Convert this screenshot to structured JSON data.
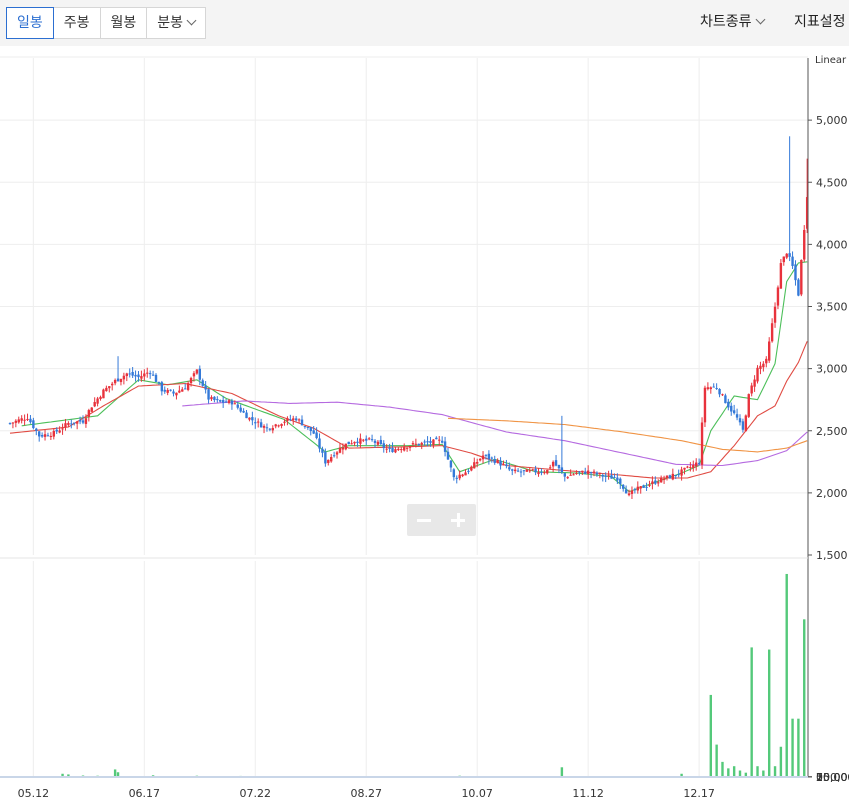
{
  "toolbar": {
    "tabs": [
      {
        "label": "일봉",
        "active": true
      },
      {
        "label": "주봉",
        "active": false
      },
      {
        "label": "월봉",
        "active": false
      },
      {
        "label": "분봉",
        "active": false
      }
    ],
    "chart_type_label": "차트종류",
    "indicator_label": "지표설정"
  },
  "colors": {
    "up": "#e8323c",
    "down": "#3479d8",
    "ma5": "#4cbf5a",
    "ma20": "#e04b43",
    "ma60": "#b56ae0",
    "ma120": "#f09445",
    "volume": "#54c97a"
  },
  "chart_data": [
    {
      "type": "candlestick",
      "scale_label": "Linear",
      "y_ticks": [
        "5,000",
        "4,500",
        "4,000",
        "3,500",
        "3,000",
        "2,500",
        "2,000",
        "1,500"
      ],
      "ylim": [
        1500,
        5500
      ],
      "x_ticks": [
        "05.12",
        "06.17",
        "07.22",
        "08.27",
        "10.07",
        "11.12",
        "12.17"
      ],
      "series": [
        {
          "kind": "price",
          "keypoints": [
            [
              0,
              2560
            ],
            [
              6,
              2610
            ],
            [
              10,
              2460
            ],
            [
              15,
              2480
            ],
            [
              20,
              2560
            ],
            [
              25,
              2580
            ],
            [
              28,
              2700
            ],
            [
              32,
              2820
            ],
            [
              36,
              2900
            ],
            [
              40,
              2960
            ],
            [
              44,
              2930
            ],
            [
              48,
              2980
            ],
            [
              52,
              2830
            ],
            [
              56,
              2800
            ],
            [
              60,
              2850
            ],
            [
              64,
              2980
            ],
            [
              68,
              2760
            ],
            [
              72,
              2730
            ],
            [
              76,
              2730
            ],
            [
              82,
              2600
            ],
            [
              88,
              2520
            ],
            [
              94,
              2580
            ],
            [
              98,
              2600
            ],
            [
              104,
              2480
            ],
            [
              108,
              2250
            ],
            [
              114,
              2380
            ],
            [
              118,
              2420
            ],
            [
              124,
              2420
            ],
            [
              130,
              2340
            ],
            [
              136,
              2380
            ],
            [
              142,
              2400
            ],
            [
              148,
              2420
            ],
            [
              152,
              2120
            ],
            [
              157,
              2180
            ],
            [
              162,
              2300
            ],
            [
              167,
              2250
            ],
            [
              172,
              2170
            ],
            [
              178,
              2170
            ],
            [
              184,
              2180
            ],
            [
              186,
              2250
            ],
            [
              190,
              2130
            ],
            [
              194,
              2160
            ],
            [
              198,
              2170
            ],
            [
              204,
              2130
            ],
            [
              208,
              2120
            ],
            [
              212,
              1980
            ],
            [
              214,
              2020
            ],
            [
              218,
              2060
            ],
            [
              222,
              2100
            ],
            [
              226,
              2130
            ],
            [
              230,
              2170
            ],
            [
              234,
              2220
            ],
            [
              236,
              2250
            ],
            [
              238,
              2850
            ],
            [
              242,
              2850
            ],
            [
              246,
              2700
            ],
            [
              249,
              2600
            ],
            [
              251,
              2500
            ],
            [
              253,
              2780
            ],
            [
              256,
              3000
            ],
            [
              259,
              3060
            ],
            [
              262,
              3500
            ],
            [
              264,
              3840
            ],
            [
              266,
              3940
            ],
            [
              268,
              3820
            ],
            [
              270,
              3600
            ],
            [
              273,
              4400
            ]
          ]
        },
        {
          "kind": "ma",
          "name": "",
          "color_key": "ma5",
          "from": 4,
          "keypoints": [
            [
              4,
              2540
            ],
            [
              30,
              2620
            ],
            [
              44,
              2910
            ],
            [
              54,
              2870
            ],
            [
              64,
              2910
            ],
            [
              74,
              2760
            ],
            [
              94,
              2590
            ],
            [
              108,
              2330
            ],
            [
              116,
              2380
            ],
            [
              136,
              2380
            ],
            [
              148,
              2390
            ],
            [
              154,
              2170
            ],
            [
              166,
              2270
            ],
            [
              180,
              2170
            ],
            [
              194,
              2160
            ],
            [
              206,
              2130
            ],
            [
              212,
              2010
            ],
            [
              230,
              2160
            ],
            [
              236,
              2220
            ],
            [
              240,
              2500
            ],
            [
              248,
              2780
            ],
            [
              256,
              2750
            ],
            [
              262,
              3040
            ],
            [
              266,
              3700
            ],
            [
              270,
              3850
            ],
            [
              273,
              3860
            ]
          ]
        },
        {
          "kind": "ma",
          "name": "",
          "color_key": "ma20",
          "from": 0,
          "keypoints": [
            [
              0,
              2480
            ],
            [
              20,
              2530
            ],
            [
              32,
              2700
            ],
            [
              44,
              2860
            ],
            [
              60,
              2880
            ],
            [
              76,
              2800
            ],
            [
              92,
              2620
            ],
            [
              104,
              2520
            ],
            [
              116,
              2360
            ],
            [
              134,
              2370
            ],
            [
              148,
              2380
            ],
            [
              158,
              2320
            ],
            [
              170,
              2220
            ],
            [
              190,
              2180
            ],
            [
              206,
              2150
            ],
            [
              220,
              2120
            ],
            [
              232,
              2120
            ],
            [
              240,
              2170
            ],
            [
              248,
              2380
            ],
            [
              256,
              2620
            ],
            [
              262,
              2700
            ],
            [
              266,
              2900
            ],
            [
              270,
              3050
            ],
            [
              273,
              3220
            ]
          ]
        },
        {
          "kind": "ma",
          "name": "",
          "color_key": "ma60",
          "from": 59,
          "keypoints": [
            [
              59,
              2700
            ],
            [
              80,
              2740
            ],
            [
              96,
              2720
            ],
            [
              112,
              2730
            ],
            [
              130,
              2690
            ],
            [
              148,
              2630
            ],
            [
              170,
              2490
            ],
            [
              190,
              2420
            ],
            [
              210,
              2320
            ],
            [
              228,
              2230
            ],
            [
              244,
              2220
            ],
            [
              256,
              2260
            ],
            [
              266,
              2340
            ],
            [
              273,
              2490
            ]
          ]
        },
        {
          "kind": "ma",
          "name": "",
          "color_key": "ma120",
          "from": 150,
          "keypoints": [
            [
              150,
              2600
            ],
            [
              170,
              2580
            ],
            [
              190,
              2550
            ],
            [
              210,
              2490
            ],
            [
              230,
              2420
            ],
            [
              244,
              2350
            ],
            [
              256,
              2330
            ],
            [
              266,
              2360
            ],
            [
              273,
              2420
            ]
          ]
        }
      ],
      "annotations": [
        {
          "day": 37,
          "high": 3100
        },
        {
          "day": 189,
          "high": 2620
        },
        {
          "day": 267,
          "high": 4870
        },
        {
          "day": 273,
          "high": 4690
        }
      ]
    },
    {
      "type": "bar",
      "name": "volume",
      "y_ticks": [
        "100,000,",
        "75,000,",
        "50,000,",
        "25,000,",
        "0"
      ],
      "ylim": [
        0,
        100000000
      ],
      "bars": [
        [
          18,
          1500000
        ],
        [
          20,
          1200000
        ],
        [
          25,
          700000
        ],
        [
          30,
          600000
        ],
        [
          36,
          3500000
        ],
        [
          37,
          2200000
        ],
        [
          49,
          800000
        ],
        [
          64,
          600000
        ],
        [
          79,
          500000
        ],
        [
          119,
          400000
        ],
        [
          154,
          600000
        ],
        [
          189,
          4500000
        ],
        [
          230,
          1500000
        ],
        [
          240,
          38000000
        ],
        [
          242,
          15000000
        ],
        [
          244,
          7000000
        ],
        [
          246,
          4000000
        ],
        [
          248,
          5000000
        ],
        [
          250,
          3000000
        ],
        [
          252,
          2000000
        ],
        [
          254,
          60000000
        ],
        [
          256,
          5000000
        ],
        [
          258,
          3000000
        ],
        [
          260,
          59000000
        ],
        [
          262,
          5000000
        ],
        [
          264,
          14000000
        ],
        [
          266,
          94000000
        ],
        [
          268,
          27000000
        ],
        [
          270,
          27000000
        ],
        [
          272,
          73000000
        ]
      ]
    }
  ]
}
